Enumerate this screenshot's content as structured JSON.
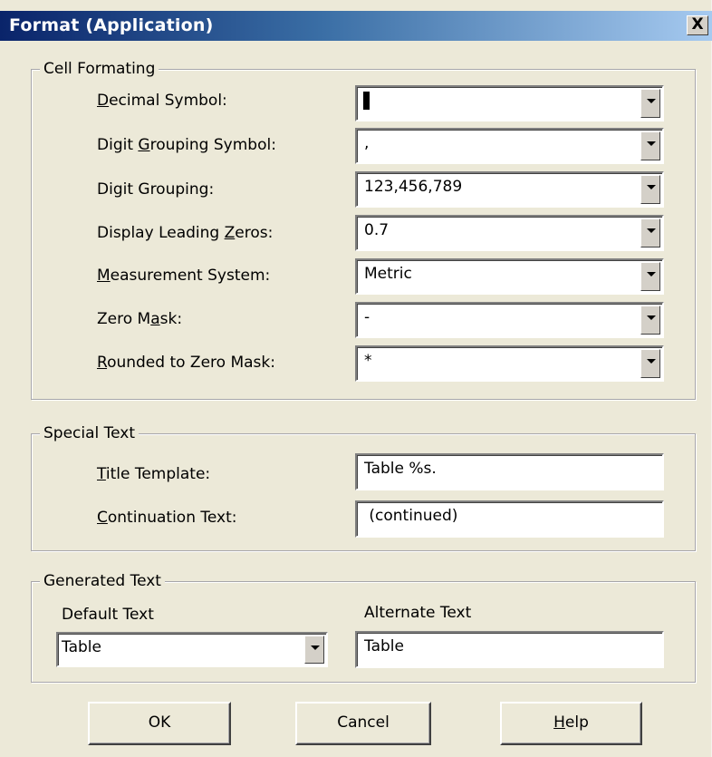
{
  "window": {
    "title": "Format (Application)",
    "close_glyph": "X"
  },
  "cell_formatting": {
    "legend": "Cell Formating",
    "rows": [
      {
        "label_pre": "",
        "label_key": "D",
        "label_post": "ecimal Symbol:",
        "value": ""
      },
      {
        "label_pre": "Digit ",
        "label_key": "G",
        "label_post": "rouping Symbol:",
        "value": ","
      },
      {
        "label_pre": "Digit Grouping:",
        "label_key": "",
        "label_post": "",
        "value": "123,456,789"
      },
      {
        "label_pre": "Display Leading ",
        "label_key": "Z",
        "label_post": "eros:",
        "value": "0.7"
      },
      {
        "label_pre": "",
        "label_key": "M",
        "label_post": "easurement System:",
        "value": "Metric"
      },
      {
        "label_pre": "Zero M",
        "label_key": "a",
        "label_post": "sk:",
        "value": "-"
      },
      {
        "label_pre": "",
        "label_key": "R",
        "label_post": "ounded to Zero Mask:",
        "value": "*"
      }
    ]
  },
  "special_text": {
    "legend": "Special Text",
    "title_template": {
      "label_key": "T",
      "label_post": "itle Template:",
      "value": "Table %s."
    },
    "continuation": {
      "label_key": "C",
      "label_post": "ontinuation Text:",
      "value": " (continued)"
    }
  },
  "generated_text": {
    "legend": "Generated Text",
    "default_label": "Default Text",
    "default_value": "Table",
    "alternate_label": "Alternate Text",
    "alternate_value": "Table"
  },
  "buttons": {
    "ok": "OK",
    "cancel": "Cancel",
    "help_key": "H",
    "help_post": "elp"
  },
  "icons": {
    "dropdown": "chevron-down-icon",
    "close": "close-icon"
  }
}
